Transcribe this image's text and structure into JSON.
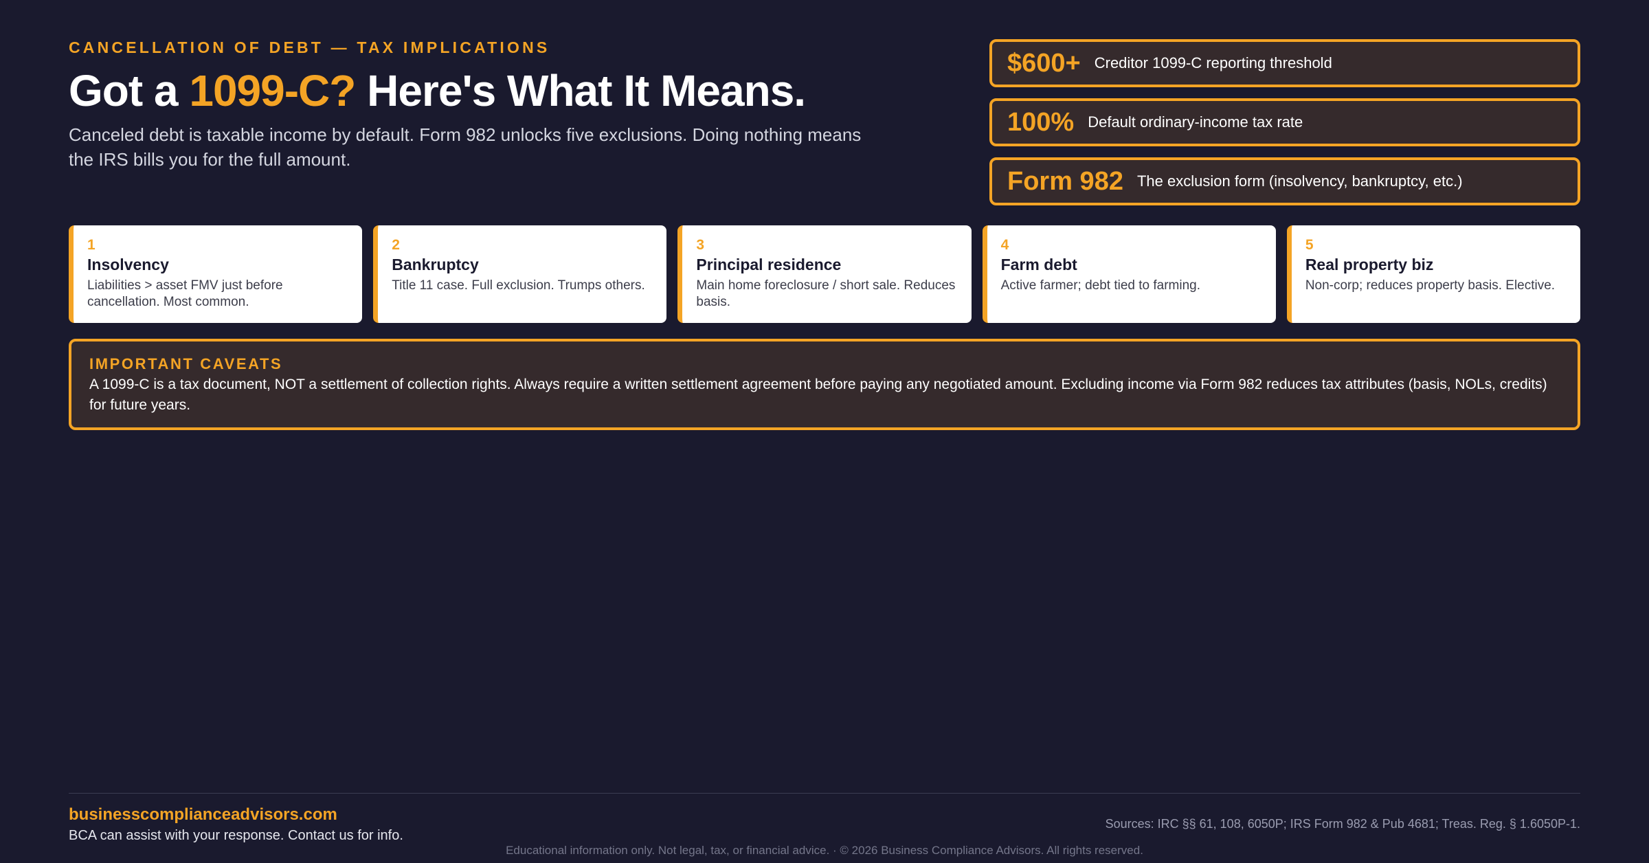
{
  "header": {
    "eyebrow": "CANCELLATION OF DEBT — TAX IMPLICATIONS",
    "headline_pre": "Got a ",
    "headline_accent": "1099-C?",
    "headline_post": " Here's What It Means.",
    "subhead": "Canceled debt is taxable income by default. Form 982 unlocks five exclusions. Doing nothing means the IRS bills you for the full amount."
  },
  "stats": [
    {
      "value": "$600+",
      "label": "Creditor 1099-C reporting threshold"
    },
    {
      "value": "100%",
      "label": "Default ordinary-income tax rate"
    },
    {
      "value": "Form 982",
      "label": "The exclusion form (insolvency, bankruptcy, etc.)"
    }
  ],
  "exclusions": [
    {
      "num": "1",
      "title": "Insolvency",
      "desc": "Liabilities > asset FMV just before cancellation. Most common."
    },
    {
      "num": "2",
      "title": "Bankruptcy",
      "desc": "Title 11 case. Full exclusion. Trumps others."
    },
    {
      "num": "3",
      "title": "Principal residence",
      "desc": "Main home foreclosure / short sale. Reduces basis."
    },
    {
      "num": "4",
      "title": "Farm debt",
      "desc": "Active farmer; debt tied to farming."
    },
    {
      "num": "5",
      "title": "Real property biz",
      "desc": "Non-corp; reduces property basis. Elective."
    }
  ],
  "caveats": {
    "title": "IMPORTANT CAVEATS",
    "text": "A 1099-C is a tax document, NOT a settlement of collection rights. Always require a written settlement agreement before paying any negotiated amount. Excluding income via Form 982 reduces tax attributes (basis, NOLs, credits) for future years."
  },
  "footer": {
    "site": "businesscomplianceadvisors.com",
    "contact": "BCA can assist with your response. Contact us for info.",
    "sources": "Sources: IRC §§ 61, 108, 6050P; IRS Form 982 & Pub 4681; Treas. Reg. § 1.6050P-1.",
    "legal": "Educational information only. Not legal, tax, or financial advice.  ·  © 2026 Business Compliance Advisors. All rights reserved."
  },
  "colors": {
    "background": "#1a1a2e",
    "accent": "#f4a425",
    "panel": "#352a2c",
    "card": "#ffffff"
  }
}
